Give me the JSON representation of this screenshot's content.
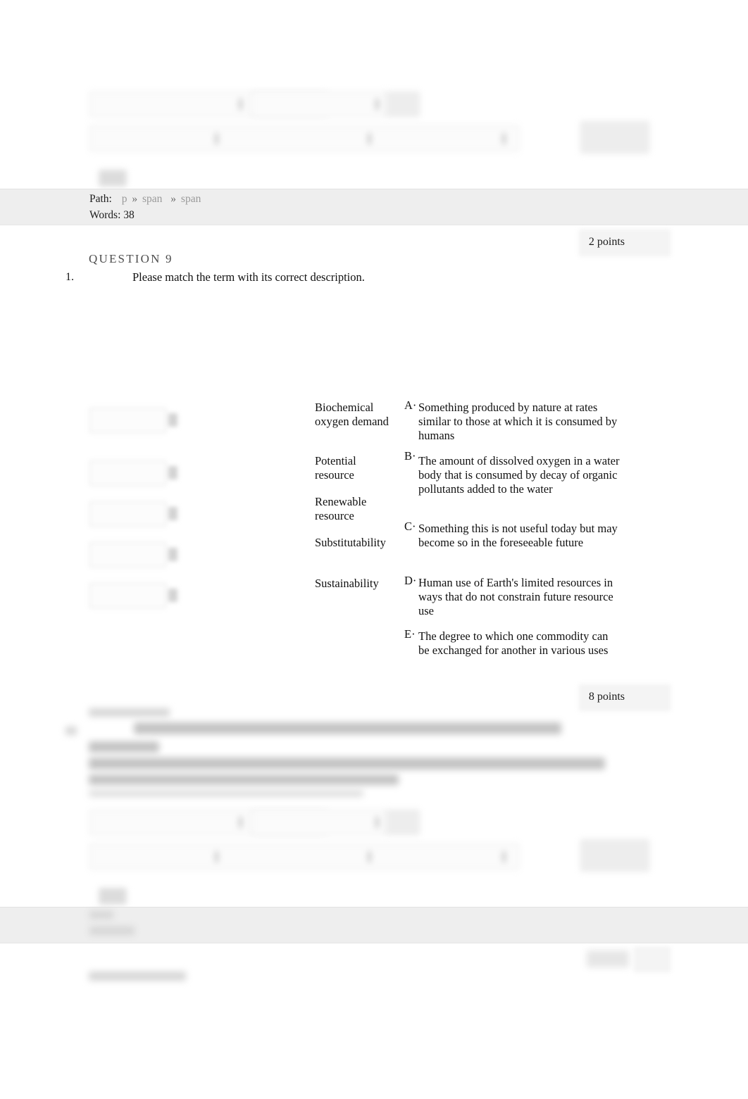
{
  "editor_top": {
    "status": {
      "path_label": "Path:",
      "path_segments": [
        "p",
        "span",
        "span"
      ],
      "separator": "»",
      "words_label": "Words:",
      "words_count": "38",
      "words_line": "Words: 38"
    }
  },
  "question9": {
    "points_badge": "2 points",
    "heading": "QUESTION 9",
    "item_number": "1.",
    "prompt": "Please match the term with its correct description.",
    "terms": [
      {
        "label": "Biochemical oxygen demand",
        "selected_value": "",
        "dropdown_icon": "chevron-down-icon"
      },
      {
        "label": "Potential resource",
        "selected_value": "",
        "dropdown_icon": "chevron-down-icon"
      },
      {
        "label": "Renewable resource",
        "selected_value": "",
        "dropdown_icon": "chevron-down-icon"
      },
      {
        "label": "Substitutability",
        "selected_value": "",
        "dropdown_icon": "chevron-down-icon"
      },
      {
        "label": "Sustainability",
        "selected_value": "",
        "dropdown_icon": "chevron-down-icon"
      }
    ],
    "descriptions": [
      {
        "letter": "A",
        "marker": "A·",
        "text": "Something produced by nature at rates similar to those at which it is consumed by humans"
      },
      {
        "letter": "B",
        "marker": "B·",
        "text": "The amount of dissolved oxygen in a water body that is consumed by decay of organic pollutants added to the water"
      },
      {
        "letter": "C",
        "marker": "C·",
        "text": "Something this is not useful today but may become so in the foreseeable future"
      },
      {
        "letter": "D",
        "marker": "D·",
        "text": "Human use of Earth's limited resources in ways that do not constrain future resource use"
      },
      {
        "letter": "E",
        "marker": "E·",
        "text": "The degree to which one commodity can be exchanged for another in various uses"
      }
    ]
  },
  "question10": {
    "points_badge": "8 points"
  },
  "colors": {
    "page_background": "#ffffff",
    "status_bar": "#eeeeee",
    "text": "#1a1a1a",
    "heading_gray": "#4d4d4d",
    "path_dim": "#9a9a9a",
    "control_border": "#e0e0e0",
    "control_fill": "#fcfcfc",
    "caret_gray": "#d2d2d2"
  }
}
